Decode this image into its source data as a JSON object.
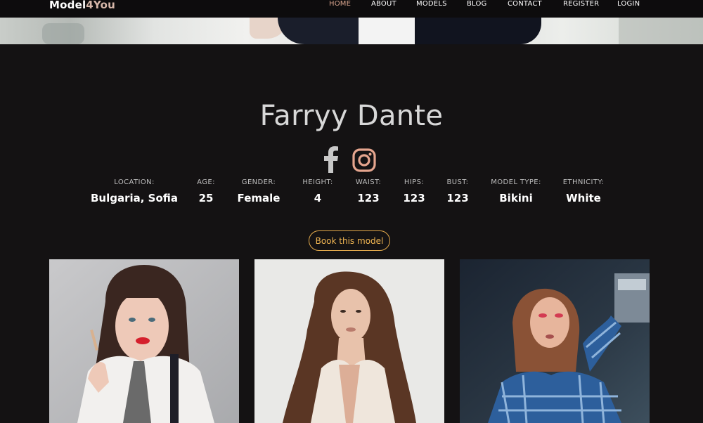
{
  "header": {
    "logo_part1": "Model",
    "logo_part2": "4You",
    "nav": [
      {
        "label": "HOME",
        "active": true
      },
      {
        "label": "ABOUT",
        "active": false
      },
      {
        "label": "MODELS",
        "active": false
      },
      {
        "label": "BLOG",
        "active": false
      },
      {
        "label": "CONTACT",
        "active": false
      },
      {
        "label": "REGISTER",
        "active": false
      },
      {
        "label": "LOGIN",
        "active": false
      }
    ]
  },
  "profile": {
    "name": "Farryy Dante",
    "social": [
      "facebook-icon",
      "instagram-icon"
    ],
    "stats": [
      {
        "label": "LOCATION:",
        "value": "Bulgaria, Sofia"
      },
      {
        "label": "AGE:",
        "value": "25"
      },
      {
        "label": "GENDER:",
        "value": "Female"
      },
      {
        "label": "HEIGHT:",
        "value": "4"
      },
      {
        "label": "WAIST:",
        "value": "123"
      },
      {
        "label": "HIPS:",
        "value": "123"
      },
      {
        "label": "BUST:",
        "value": "123"
      },
      {
        "label": "MODEL TYPE:",
        "value": "Bikini"
      },
      {
        "label": "ETHNICITY:",
        "value": "White"
      }
    ],
    "book_label": "Book this model"
  },
  "colors": {
    "background": "#141213",
    "accent_nav": "#d9a58e",
    "button_border": "#e1a84b",
    "button_text": "#f0b552",
    "instagram": "#e5a58e",
    "facebook": "#c8c8c8"
  }
}
